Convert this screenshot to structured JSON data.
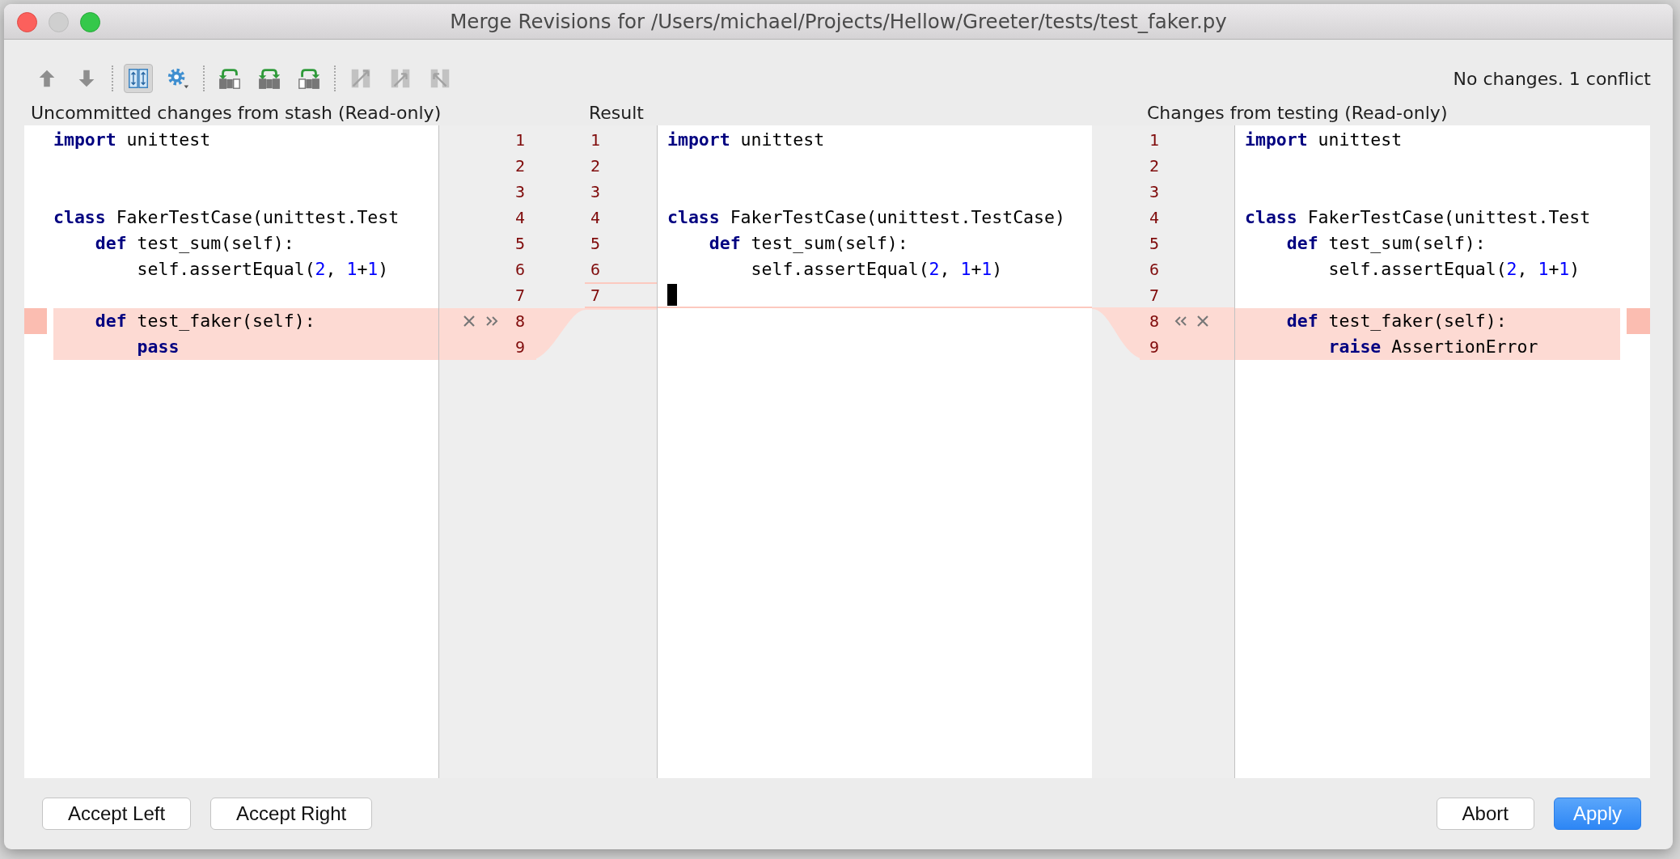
{
  "window": {
    "title": "Merge Revisions for /Users/michael/Projects/Hellow/Greeter/tests/test_faker.py"
  },
  "toolbar": [
    {
      "kind": "up",
      "pressed": false,
      "disabled": false
    },
    {
      "kind": "down",
      "pressed": false,
      "disabled": false
    },
    {
      "kind": "separator"
    },
    {
      "kind": "sync",
      "pressed": true,
      "disabled": false
    },
    {
      "kind": "settings",
      "pressed": false,
      "disabled": false
    },
    {
      "kind": "separator"
    },
    {
      "kind": "applyleft",
      "pressed": false,
      "disabled": false
    },
    {
      "kind": "applyboth",
      "pressed": false,
      "disabled": false
    },
    {
      "kind": "applyright",
      "pressed": false,
      "disabled": false
    },
    {
      "kind": "separator"
    },
    {
      "kind": "resolve",
      "pressed": false,
      "disabled": true
    },
    {
      "kind": "takeleft",
      "pressed": false,
      "disabled": true
    },
    {
      "kind": "takeright",
      "pressed": false,
      "disabled": true
    }
  ],
  "status": "No changes. 1 conflict",
  "panels": [
    {
      "kind": "left",
      "header": "Uncommitted changes from stash (Read-only)",
      "lines": [
        {
          "number": "1",
          "tokens": [
            {
              "kind": "keyword",
              "text": "import"
            },
            {
              "kind": "plain",
              "text": " unittest"
            }
          ],
          "conflict": false
        },
        {
          "number": "2",
          "conflict": false
        },
        {
          "number": "3",
          "conflict": false
        },
        {
          "number": "4",
          "tokens": [
            {
              "kind": "keyword",
              "text": "class"
            },
            {
              "kind": "plain",
              "text": " FakerTestCase(unittest.Test"
            }
          ],
          "conflict": false
        },
        {
          "number": "5",
          "tokens": [
            {
              "kind": "keyword",
              "text": "    def"
            },
            {
              "kind": "plain",
              "text": " test_sum(self):"
            }
          ],
          "conflict": false
        },
        {
          "number": "6",
          "tokens": [
            {
              "kind": "plain",
              "text": "        self.assertEqual("
            },
            {
              "kind": "number",
              "text": "2"
            },
            {
              "kind": "plain",
              "text": ", "
            },
            {
              "kind": "number",
              "text": "1"
            },
            {
              "kind": "plain",
              "text": "+"
            },
            {
              "kind": "number",
              "text": "1"
            },
            {
              "kind": "plain",
              "text": ")"
            }
          ],
          "conflict": false
        },
        {
          "number": "7",
          "conflict": false
        },
        {
          "number": "8",
          "tokens": [
            {
              "kind": "keyword",
              "text": "    def"
            },
            {
              "kind": "plain",
              "text": " test_faker(self):"
            }
          ],
          "conflict": true
        },
        {
          "number": "9",
          "tokens": [
            {
              "kind": "keyword",
              "text": "        pass"
            }
          ],
          "conflict": true
        }
      ]
    },
    {
      "kind": "result",
      "header": "Result",
      "lines": [
        {
          "number": "1",
          "tokens": [
            {
              "kind": "keyword",
              "text": "import"
            },
            {
              "kind": "plain",
              "text": " unittest"
            }
          ],
          "conflict": false
        },
        {
          "number": "2",
          "conflict": false
        },
        {
          "number": "3",
          "conflict": false
        },
        {
          "number": "4",
          "tokens": [
            {
              "kind": "keyword",
              "text": "class"
            },
            {
              "kind": "plain",
              "text": " FakerTestCase(unittest.TestCase)"
            }
          ],
          "conflict": false
        },
        {
          "number": "5",
          "tokens": [
            {
              "kind": "keyword",
              "text": "    def"
            },
            {
              "kind": "plain",
              "text": " test_sum(self):"
            }
          ],
          "conflict": false
        },
        {
          "number": "6",
          "tokens": [
            {
              "kind": "plain",
              "text": "        self.assertEqual("
            },
            {
              "kind": "number",
              "text": "2"
            },
            {
              "kind": "plain",
              "text": ", "
            },
            {
              "kind": "number",
              "text": "1"
            },
            {
              "kind": "plain",
              "text": "+"
            },
            {
              "kind": "number",
              "text": "1"
            },
            {
              "kind": "plain",
              "text": ")"
            }
          ],
          "conflict": false
        },
        {
          "number": "7",
          "tokens": [
            {
              "kind": "caret"
            }
          ],
          "conflict": true
        }
      ]
    },
    {
      "kind": "right",
      "header": "Changes from testing (Read-only)",
      "lines": [
        {
          "number": "1",
          "tokens": [
            {
              "kind": "keyword",
              "text": "import"
            },
            {
              "kind": "plain",
              "text": " unittest"
            }
          ],
          "conflict": false
        },
        {
          "number": "2",
          "conflict": false
        },
        {
          "number": "3",
          "conflict": false
        },
        {
          "number": "4",
          "tokens": [
            {
              "kind": "keyword",
              "text": "class"
            },
            {
              "kind": "plain",
              "text": " FakerTestCase(unittest.Test"
            }
          ],
          "conflict": false
        },
        {
          "number": "5",
          "tokens": [
            {
              "kind": "keyword",
              "text": "    def"
            },
            {
              "kind": "plain",
              "text": " test_sum(self):"
            }
          ],
          "conflict": false
        },
        {
          "number": "6",
          "tokens": [
            {
              "kind": "plain",
              "text": "        self.assertEqual("
            },
            {
              "kind": "number",
              "text": "2"
            },
            {
              "kind": "plain",
              "text": ", "
            },
            {
              "kind": "number",
              "text": "1"
            },
            {
              "kind": "plain",
              "text": "+"
            },
            {
              "kind": "number",
              "text": "1"
            },
            {
              "kind": "plain",
              "text": ")"
            }
          ],
          "conflict": false
        },
        {
          "number": "7",
          "conflict": false
        },
        {
          "number": "8",
          "tokens": [
            {
              "kind": "keyword",
              "text": "    def"
            },
            {
              "kind": "plain",
              "text": " test_faker(self):"
            }
          ],
          "conflict": true
        },
        {
          "number": "9",
          "tokens": [
            {
              "kind": "keyword",
              "text": "        raise"
            },
            {
              "kind": "plain",
              "text": " AssertionError"
            }
          ],
          "conflict": true
        }
      ]
    }
  ],
  "footer": {
    "left_buttons": [
      {
        "label": "Accept Left",
        "primary": false
      },
      {
        "label": "Accept Right",
        "primary": false
      }
    ],
    "right_buttons": [
      {
        "label": "Abort",
        "primary": false
      },
      {
        "label": "Apply",
        "primary": true
      }
    ]
  }
}
